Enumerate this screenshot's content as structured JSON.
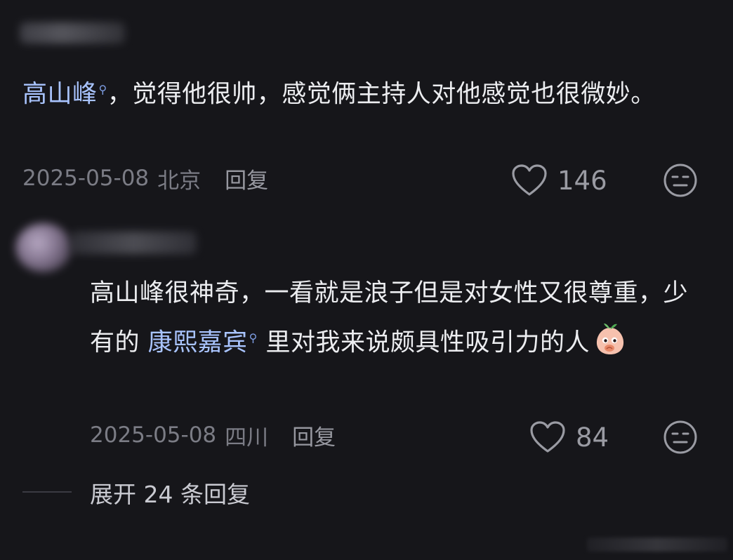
{
  "comment1": {
    "mention": "高山峰",
    "text": "，觉得他很帅，感觉俩主持人对他感觉也很微妙。",
    "date": "2025-05-08",
    "location": "北京",
    "reply_label": "回复",
    "likes": "146"
  },
  "comment2": {
    "text_before": "高山峰很神奇，一看就是浪子但是对女性又很尊重，少有的 ",
    "link": "康熙嘉宾",
    "text_after": " 里对我来说颇具性吸引力的人",
    "date": "2025-05-08",
    "location": "四川",
    "reply_label": "回复",
    "likes": "84"
  },
  "expand_replies": "展开 24 条回复",
  "icons": {
    "search": "search-icon",
    "heart": "heart-icon",
    "dislike": "expressionless-face-icon",
    "emoji": "peach-emoji-icon"
  },
  "colors": {
    "background": "#16161a",
    "link": "#a9c4ff",
    "meta": "#7b7c85"
  }
}
